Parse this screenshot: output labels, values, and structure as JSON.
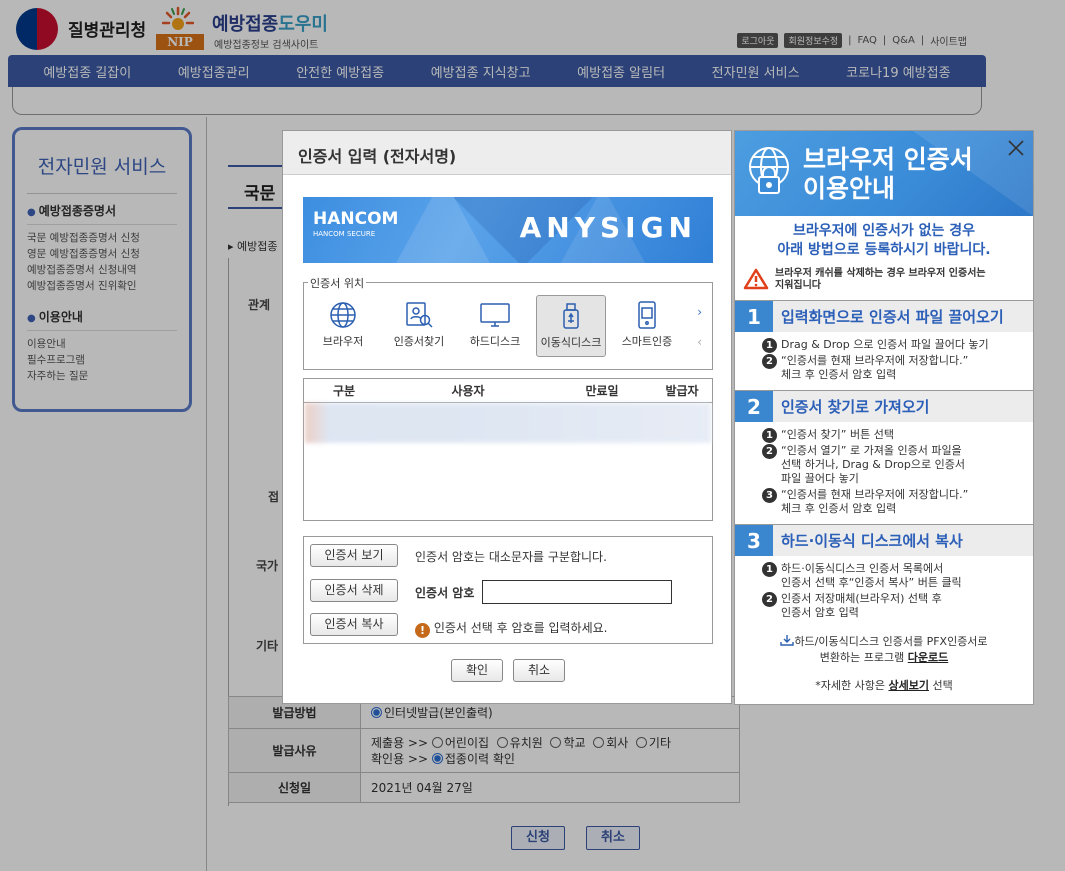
{
  "header": {
    "org_name": "질병관리청",
    "nip_badge": "NIP",
    "site_title_a": "예방접종",
    "site_title_b": "도우미",
    "site_subtitle": "예방접종정보 검색사이트",
    "util": {
      "logout": "로그아웃",
      "member_info": "회원정보수정",
      "faq": "FAQ",
      "qa": "Q&A",
      "sitemap": "사이트맵"
    }
  },
  "nav": [
    "예방접종 길잡이",
    "예방접종관리",
    "안전한 예방접종",
    "예방접종 지식창고",
    "예방접종 알림터",
    "전자민원 서비스",
    "코로나19 예방접종"
  ],
  "sidebar": {
    "title": "전자민원 서비스",
    "sections": [
      {
        "title": "예방접종증명서",
        "items": [
          "국문 예방접종증명서 신청",
          "영문 예방접종증명서 신청",
          "예방접종증명서 신청내역",
          "예방접종증명서 진위확인"
        ]
      },
      {
        "title": "이용안내",
        "items": [
          "이용안내",
          "필수프로그램",
          "자주하는 질문"
        ]
      }
    ]
  },
  "page": {
    "heading": "국문",
    "crumb": "예방접종",
    "row_labels": [
      "관계",
      "접",
      "국가",
      "기타"
    ]
  },
  "form": {
    "method_label": "발급방법",
    "method_value": "인터넷발급(본인출력)",
    "reason_label": "발급사유",
    "reason_submit_prefix": "제출용 >>",
    "reason_submit_options": [
      "어린이집",
      "유치원",
      "학교",
      "회사",
      "기타"
    ],
    "reason_check_prefix": "확인용 >>",
    "reason_check_option": "접종이력 확인",
    "date_label": "신청일",
    "date_value": "2021년 04월 27일",
    "apply_button": "신청",
    "cancel_button": "취소"
  },
  "modal": {
    "title": "인증서 입력 (전자서명)",
    "banner_brand": "HANCOM",
    "banner_brand_sub": "HANCOM SECURE",
    "banner_product": "ANYSIGN",
    "location_legend": "인증서 위치",
    "locations": [
      "브라우저",
      "인증서찾기",
      "하드디스크",
      "이동식디스크",
      "스마트인증"
    ],
    "list_headers": [
      "구분",
      "사용자",
      "만료일",
      "발급자"
    ],
    "view_button": "인증서 보기",
    "delete_button": "인증서 삭제",
    "copy_button": "인증서 복사",
    "case_notice": "인증서 암호는 대소문자를 구분합니다.",
    "password_label": "인증서 암호",
    "password_value": "",
    "select_notice": "인증서 선택 후 암호를 입력하세요.",
    "ok_button": "확인",
    "cancel_button": "취소"
  },
  "guide": {
    "title_line1": "브라우저 인증서",
    "title_line2": "이용안내",
    "intro_line1": "브라우저에 인증서가 없는 경우",
    "intro_line2": "아래 방법으로 등록하시기 바랍니다.",
    "warning_line1": "브라우저 캐쉬를 삭제하는 경우 브라우저 인증서는",
    "warning_line2": "지워집니다",
    "sections": [
      {
        "num": "1",
        "title": "입력화면으로 인증서 파일 끌어오기",
        "steps": [
          {
            "n": "1",
            "lines": [
              "Drag & Drop 으로 인증서 파일 끌어다 놓기"
            ]
          },
          {
            "n": "2",
            "lines": [
              "“인증서를 현재 브라우저에 저장합니다.”",
              "체크 후 인증서 암호 입력"
            ]
          }
        ]
      },
      {
        "num": "2",
        "title": "인증서 찾기로 가져오기",
        "steps": [
          {
            "n": "1",
            "lines": [
              "“인증서 찾기” 버튼 선택"
            ]
          },
          {
            "n": "2",
            "lines": [
              "“인증서 열기” 로 가져올 인증서 파일을",
              "선택 하거나, Drag & Drop으로 인증서",
              "파일 끌어다 놓기"
            ]
          },
          {
            "n": "3",
            "lines": [
              "“인증서를 현재 브라우저에 저장합니다.”",
              "체크 후 인증서 암호 입력"
            ]
          }
        ]
      },
      {
        "num": "3",
        "title": "하드·이동식 디스크에서 복사",
        "steps": [
          {
            "n": "1",
            "lines": [
              "하드·이동식디스크 인증서 목록에서",
              "인증서 선택 후“인증서 복사” 버튼 클릭"
            ]
          },
          {
            "n": "2",
            "lines": [
              "인증서 저장매체(브라우저) 선택 후",
              "인증서 암호 입력"
            ]
          }
        ]
      }
    ],
    "download_line1": "하드/이동식디스크 인증서를 PFX인증서로",
    "download_line2_prefix": "변환하는 프로그램 ",
    "download_link": "다운로드",
    "detail_prefix": "*자세한 사항은 ",
    "detail_link": "상세보기",
    "detail_suffix": " 선택"
  },
  "colors": {
    "nav_blue": "#3c5aa6",
    "banner_blue": "#3d8ee0",
    "guide_blue": "#3a86cf",
    "text_blue": "#2c5fb8"
  }
}
